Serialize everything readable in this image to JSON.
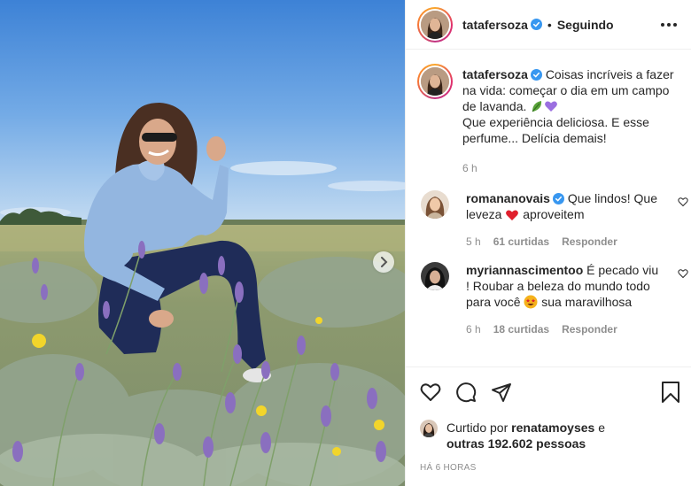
{
  "header": {
    "username": "tatafersoza",
    "separator": "•",
    "follow_status": "Seguindo",
    "more_icon": "more-horizontal-icon"
  },
  "caption": {
    "username": "tatafersoza",
    "text_line1": "Coisas incríveis a fazer na vida: começar o dia em um campo de lavanda.",
    "text_line2": "Que experiência deliciosa. E esse perfume... Delícia demais!",
    "time": "6 h"
  },
  "comments": [
    {
      "username": "romananovais",
      "text_a": "Que lindos! Que leveza",
      "text_b": "aproveitem",
      "time": "5 h",
      "likes": "61 curtidas",
      "reply": "Responder"
    },
    {
      "username": "myriannascimentoo",
      "text_a": "É pecado viu ! Roubar a beleza do mundo todo para você",
      "text_b": "sua maravilhosa",
      "time": "6 h",
      "likes": "18 curtidas",
      "reply": "Responder"
    }
  ],
  "likes_info": {
    "prefix": "Curtido por",
    "user": "renatamoyses",
    "joiner": "e",
    "others": "outras 192.602 pessoas"
  },
  "timestamp": "HÁ 6 HORAS",
  "icons": {
    "like": "heart-icon",
    "comment": "comment-icon",
    "share": "paper-plane-icon",
    "save": "bookmark-icon",
    "next": "chevron-right-icon"
  },
  "colors": {
    "verified": "#3897f0",
    "text": "#262626",
    "muted": "#8e8e8e",
    "border": "#efefef"
  }
}
